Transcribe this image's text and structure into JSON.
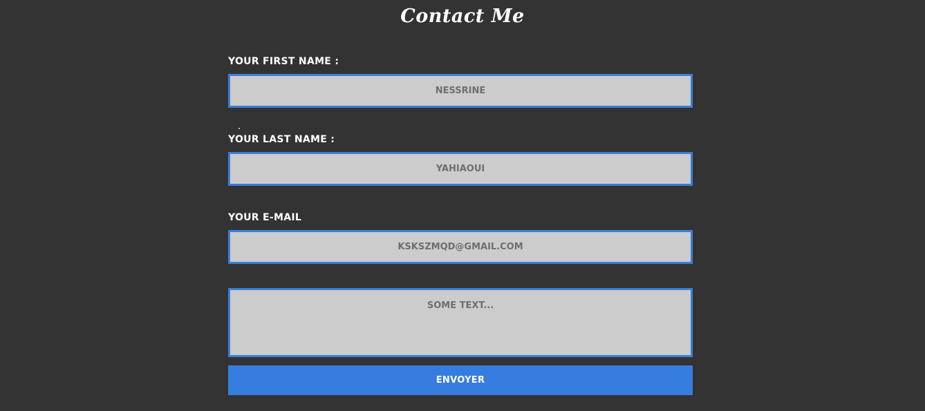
{
  "header": {
    "title": "Contact Me"
  },
  "form": {
    "first_name": {
      "label": "YOUR FIRST NAME :",
      "placeholder": "NESSRINE"
    },
    "last_name": {
      "label": "YOUR LAST NAME :",
      "placeholder": "YAHIAOUI"
    },
    "email": {
      "label": "YOUR E-MAIL",
      "placeholder": "KSKSZMQD@GMAIL.COM"
    },
    "message": {
      "placeholder": "SOME TEXT..."
    },
    "submit_label": "ENVOYER"
  },
  "colors": {
    "background": "#333333",
    "field_background": "#cccccc",
    "field_border": "#3a7fdc",
    "button": "#377ddf",
    "label_text": "#ffffff",
    "placeholder_text": "#6e6e6e"
  }
}
